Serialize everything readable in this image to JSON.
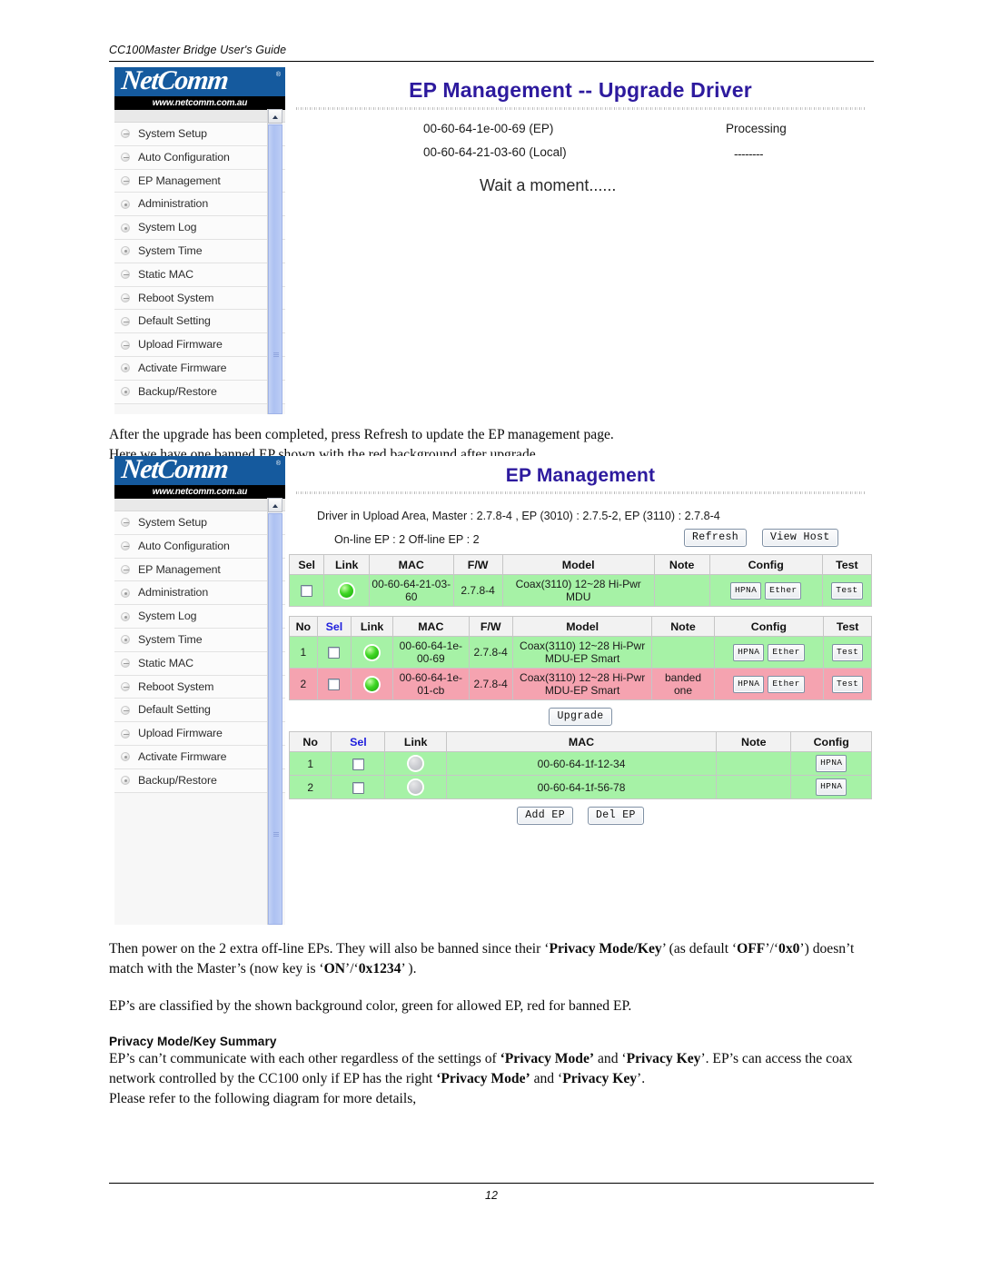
{
  "document": {
    "header_title": "CC100Master Bridge User's Guide",
    "page_number": "12"
  },
  "logo": {
    "brand": "NetComm",
    "registered": "®",
    "url": "www.netcomm.com.au"
  },
  "sidebar": {
    "items": [
      {
        "label": "System Setup"
      },
      {
        "label": "Auto Configuration"
      },
      {
        "label": "EP Management"
      },
      {
        "label": "Administration"
      },
      {
        "label": "System Log"
      },
      {
        "label": "System Time"
      },
      {
        "label": "Static MAC"
      },
      {
        "label": "Reboot System"
      },
      {
        "label": "Default Setting"
      },
      {
        "label": "Upload Firmware"
      },
      {
        "label": "Activate Firmware"
      },
      {
        "label": "Backup/Restore"
      }
    ]
  },
  "screenshot1": {
    "title": "EP Management -- Upgrade Driver",
    "rows": [
      {
        "mac": "00-60-64-1e-00-69 (EP)",
        "status": "Processing"
      },
      {
        "mac": "00-60-64-21-03-60 (Local)",
        "status": "--------"
      }
    ],
    "wait_message": "Wait a moment......"
  },
  "paragraphs": {
    "after_upgrade_line1": "After the upgrade has been completed, press Refresh to update the EP management page.",
    "after_upgrade_line2": "Here we have one banned EP shown with the red background after upgrade."
  },
  "screenshot2": {
    "title": "EP Management",
    "driver_info": "Driver in Upload Area, Master : 2.7.8-4 ,  EP (3010) : 2.7.5-2,  EP (3110) : 2.7.8-4",
    "counts": "On-line EP : 2   Off-line EP : 2",
    "refresh_button": "Refresh",
    "viewhost_button": "View Host",
    "master_table": {
      "headers": [
        "Sel",
        "Link",
        "MAC",
        "F/W",
        "Model",
        "Note",
        "Config",
        "Test"
      ],
      "rows": [
        {
          "sel": "",
          "link": "on",
          "mac": "00-60-64-21-03-60",
          "fw": "2.7.8-4",
          "model": "Coax(3110) 12~28 Hi-Pwr MDU",
          "note": "",
          "config": [
            "HPNA",
            "Ether"
          ],
          "test": "Test",
          "state": "green"
        }
      ]
    },
    "ep_table": {
      "headers": [
        "No",
        "Sel",
        "Link",
        "MAC",
        "F/W",
        "Model",
        "Note",
        "Config",
        "Test"
      ],
      "rows": [
        {
          "no": "1",
          "sel": "",
          "link": "on",
          "mac": "00-60-64-1e-00-69",
          "fw": "2.7.8-4",
          "model": "Coax(3110) 12~28 Hi-Pwr MDU-EP Smart",
          "note": "",
          "config": [
            "HPNA",
            "Ether"
          ],
          "test": "Test",
          "state": "green"
        },
        {
          "no": "2",
          "sel": "",
          "link": "on",
          "mac": "00-60-64-1e-01-cb",
          "fw": "2.7.8-4",
          "model": "Coax(3110) 12~28 Hi-Pwr MDU-EP Smart",
          "note": "banded one",
          "config": [
            "HPNA",
            "Ether"
          ],
          "test": "Test",
          "state": "red"
        }
      ]
    },
    "upgrade_button": "Upgrade",
    "offline_table": {
      "headers": [
        "No",
        "Sel",
        "Link",
        "MAC",
        "Note",
        "Config"
      ],
      "rows": [
        {
          "no": "1",
          "sel": "",
          "link": "off",
          "mac": "00-60-64-1f-12-34",
          "note": "",
          "config": [
            "HPNA"
          ],
          "state": "green"
        },
        {
          "no": "2",
          "sel": "",
          "link": "off",
          "mac": "00-60-64-1f-56-78",
          "note": "",
          "config": [
            "HPNA"
          ],
          "state": "green"
        }
      ]
    },
    "add_ep_button": "Add EP",
    "del_ep_button": "Del EP"
  },
  "body_text": {
    "p1_a": "Then power on the 2 extra off-line EPs. They will also be banned since their ‘",
    "p1_b": "Privacy Mode/Key",
    "p1_c": "’ (as default ‘",
    "p1_d": "OFF",
    "p1_e": "’/‘",
    "p1_f": "0x0",
    "p1_g": "’) doesn’t match with the Master’s (now key is ‘",
    "p1_h": "ON",
    "p1_i": "’/‘",
    "p1_j": "0x1234",
    "p1_k": "’ ).",
    "p2": "EP’s are classified by the shown background color, green for allowed EP, red for banned EP.",
    "section_title": "Privacy Mode/Key Summary",
    "p3_a": "EP’s can’t communicate with each other regardless of the settings of ",
    "p3_b": "‘Privacy Mode’",
    "p3_c": " and ‘",
    "p3_d": "Privacy Key",
    "p3_e": "’. EP’s can access the coax network controlled by the CC100 only if EP has the right ",
    "p3_f": "‘Privacy Mode’",
    "p3_g": " and ‘",
    "p3_h": "Privacy Key",
    "p3_i": "’.",
    "p4": "Please refer to the following diagram for more details,"
  },
  "colors": {
    "title_purple": "#2d1a9e",
    "allowed_green": "#a6f2a6",
    "banned_red": "#f5a3b0",
    "brand_blue": "#155a9e"
  }
}
